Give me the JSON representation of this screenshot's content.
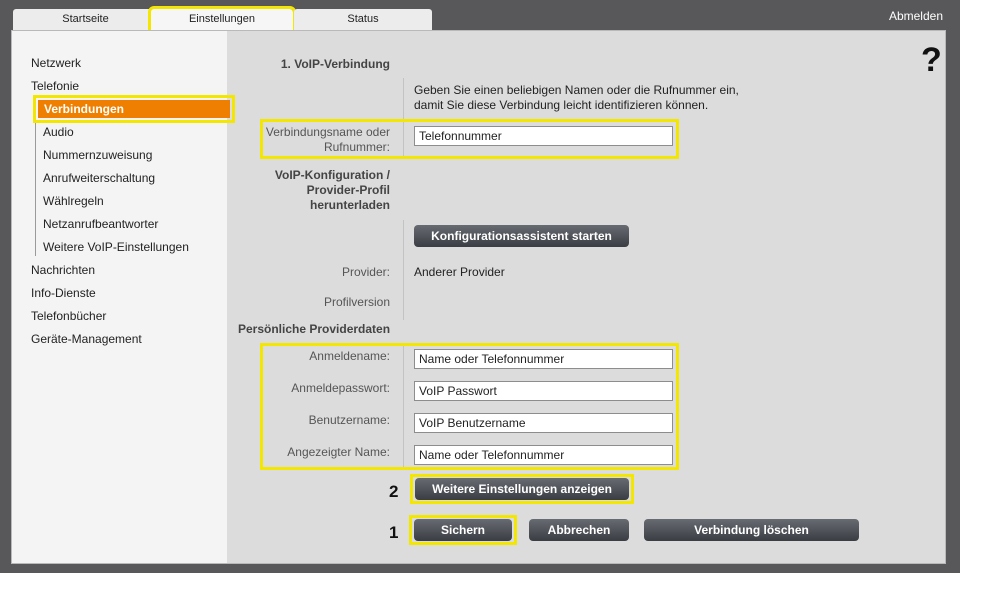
{
  "tabs": [
    "Startseite",
    "Einstellungen",
    "Status"
  ],
  "logout_label": "Abmelden",
  "help_label": "?",
  "sidebar": {
    "items": [
      "Netzwerk",
      "Telefonie"
    ],
    "telefonie_sub": [
      "Verbindungen",
      "Audio",
      "Nummernzuweisung",
      "Anrufweiterschaltung",
      "Wählregeln",
      "Netzanrufbeantworter",
      "Weitere VoIP-Einstellungen"
    ],
    "items_after": [
      "Nachrichten",
      "Info-Dienste",
      "Telefonbücher",
      "Geräte-Management"
    ]
  },
  "form": {
    "section_title": "1. VoIP-Verbindung",
    "hint_line1": "Geben Sie einen beliebigen Namen oder die Rufnummer ein,",
    "hint_line2": "damit Sie diese Verbindung leicht identifizieren können.",
    "connection_name_label_1": "Verbindungsname oder",
    "connection_name_label_2": "Rufnummer:",
    "connection_name_value": "Telefonnummer",
    "config_label_1": "VoIP-Konfiguration /",
    "config_label_2": "Provider-Profil",
    "config_label_3": "herunterladen",
    "config_wizard_button": "Konfigurationsassistent starten",
    "provider_label": "Provider:",
    "provider_value": "Anderer Provider",
    "profile_version_label": "Profilversion",
    "personal_data_title": "Persönliche Providerdaten",
    "login_name_label": "Anmeldename:",
    "login_name_value": "Name oder Telefonnummer",
    "login_password_label": "Anmeldepasswort:",
    "login_password_value": "VoIP Passwort",
    "username_label": "Benutzername:",
    "username_value": "VoIP Benutzername",
    "display_name_label": "Angezeigter Name:",
    "display_name_value": "Name oder Telefonnummer",
    "more_settings_button": "Weitere Einstellungen anzeigen",
    "save_button": "Sichern",
    "cancel_button": "Abbrechen",
    "delete_button": "Verbindung löschen"
  },
  "callouts": {
    "one": "1",
    "two": "2"
  },
  "colors": {
    "active_nav": "#ee7f00",
    "highlight": "#f3e600",
    "frame": "#58585a"
  }
}
